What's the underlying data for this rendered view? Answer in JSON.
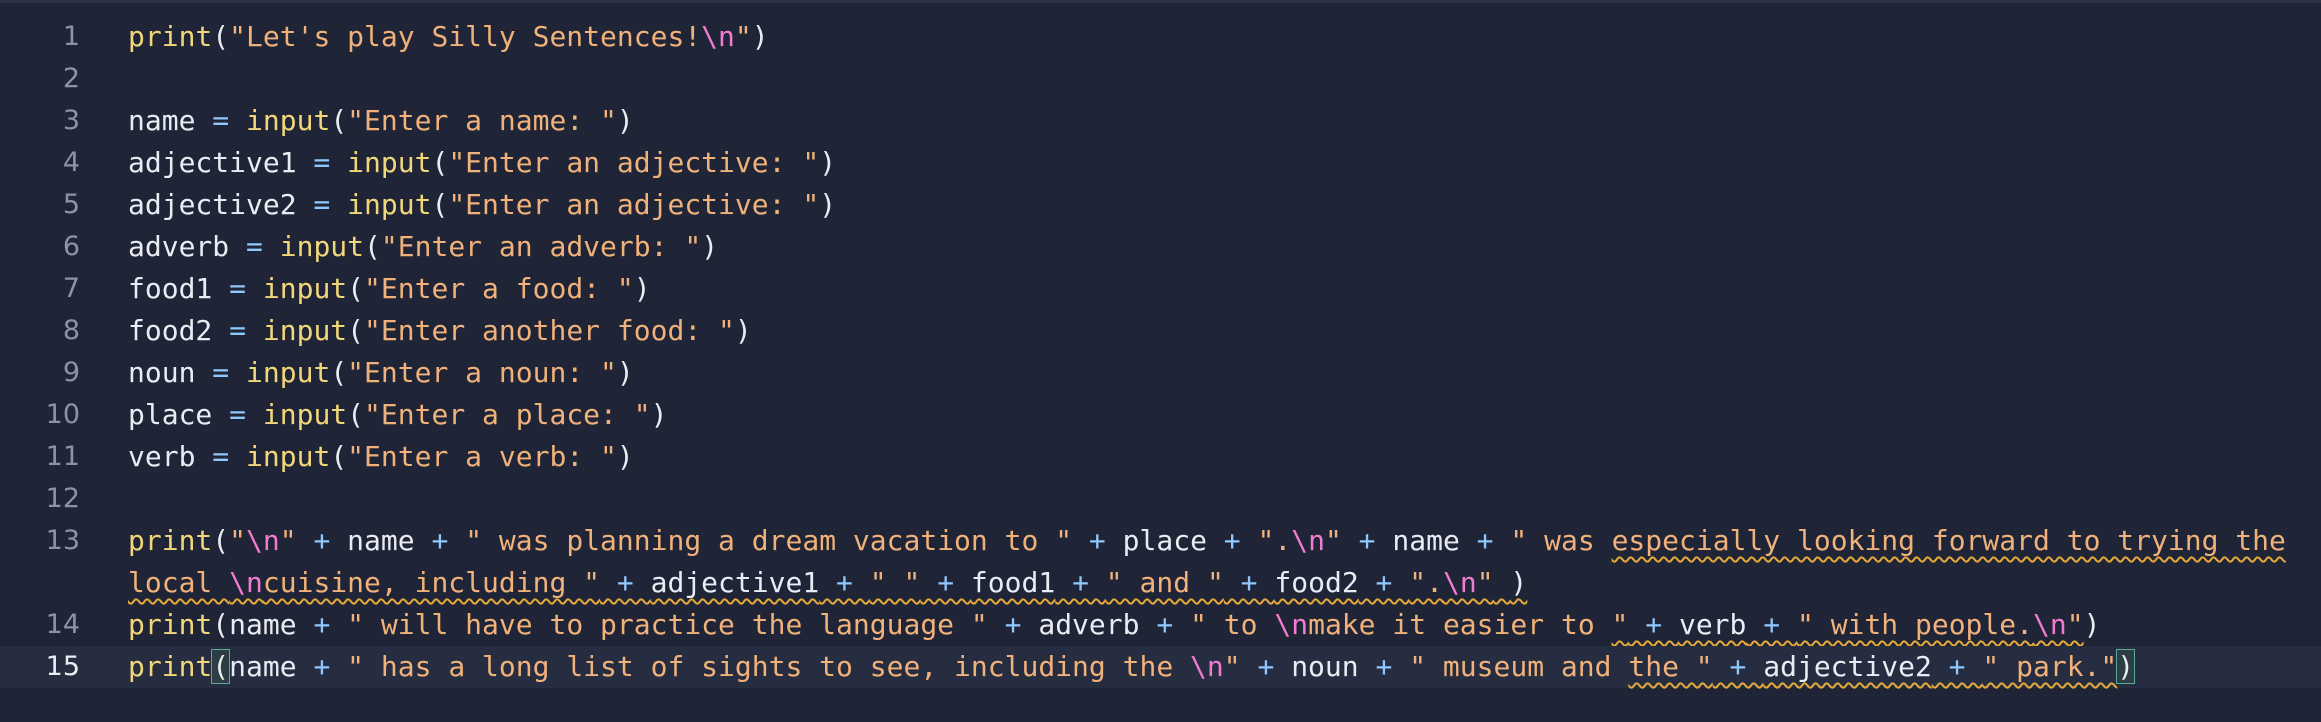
{
  "editor": {
    "active_line": "15",
    "lines": [
      {
        "number": "1",
        "t": {
          "a": "print",
          "b": "(",
          "c": "\"Let's play Silly Sentences!",
          "d": "\\n",
          "e": "\"",
          "f": ")"
        }
      },
      {
        "number": "2"
      },
      {
        "number": "3",
        "t": {
          "a": "name",
          "b": " = ",
          "c": "input",
          "d": "(",
          "e": "\"Enter a name: \"",
          "f": ")"
        }
      },
      {
        "number": "4",
        "t": {
          "a": "adjective1",
          "b": " = ",
          "c": "input",
          "d": "(",
          "e": "\"Enter an adjective: \"",
          "f": ")"
        }
      },
      {
        "number": "5",
        "t": {
          "a": "adjective2",
          "b": " = ",
          "c": "input",
          "d": "(",
          "e": "\"Enter an adjective: \"",
          "f": ")"
        }
      },
      {
        "number": "6",
        "t": {
          "a": "adverb",
          "b": " = ",
          "c": "input",
          "d": "(",
          "e": "\"Enter an adverb: \"",
          "f": ")"
        }
      },
      {
        "number": "7",
        "t": {
          "a": "food1",
          "b": " = ",
          "c": "input",
          "d": "(",
          "e": "\"Enter a food: \"",
          "f": ")"
        }
      },
      {
        "number": "8",
        "t": {
          "a": "food2",
          "b": " = ",
          "c": "input",
          "d": "(",
          "e": "\"Enter another food: \"",
          "f": ")"
        }
      },
      {
        "number": "9",
        "t": {
          "a": "noun",
          "b": " = ",
          "c": "input",
          "d": "(",
          "e": "\"Enter a noun: \"",
          "f": ")"
        }
      },
      {
        "number": "10",
        "t": {
          "a": "place",
          "b": " = ",
          "c": "input",
          "d": "(",
          "e": "\"Enter a place: \"",
          "f": ")"
        }
      },
      {
        "number": "11",
        "t": {
          "a": "verb",
          "b": " = ",
          "c": "input",
          "d": "(",
          "e": "\"Enter a verb: \"",
          "f": ")"
        }
      },
      {
        "number": "12"
      },
      {
        "number": "13",
        "t": {
          "a": "print",
          "b": "(",
          "c": "\"",
          "d": "\\n",
          "e": "\"",
          "f": " + ",
          "g": "name",
          "h": " + ",
          "i": "\" was planning a dream vacation to \"",
          "j": " + ",
          "k": "place",
          "l": " + ",
          "m": "\".",
          "n": "\\n",
          "o": "\"",
          "p": " + ",
          "q": "name",
          "r": " + ",
          "s": "\" was ",
          "u": "especially looking forward to trying the",
          "w1": "local ",
          "w2": "\\n",
          "w3": "cuisine, including \"",
          "w4": " + ",
          "w5": "adjective1",
          "w6": " + ",
          "w7": "\" \"",
          "w8": " + ",
          "w9": "food1",
          "w10": " + ",
          "w11": "\" and \"",
          "w12": " + ",
          "w13": "food2",
          "w14": " + ",
          "w15": "\".",
          "w16": "\\n",
          "w17": "\"",
          "w18": " ",
          "w19": ")"
        }
      },
      {
        "number": "14",
        "t": {
          "a": "print",
          "b": "(",
          "c": "name",
          "d": " + ",
          "e": "\" will have to practice the language \"",
          "f": " + ",
          "g": "adverb",
          "h": " + ",
          "i": "\" to ",
          "j": "\\n",
          "k": "make it easier to ",
          "l": "\"",
          "m": " + ",
          "n": "verb",
          "o": " + ",
          "p": "\" with people.",
          "q": "\\n",
          "r": "\"",
          "s": ")"
        }
      },
      {
        "number": "15",
        "t": {
          "a": "print",
          "b": "(",
          "c": "name",
          "d": " + ",
          "e": "\" has a long list of sights to see, including the ",
          "f": "\\n",
          "g": "\"",
          "h": " + ",
          "i": "noun",
          "j": " + ",
          "k": "\" museum and ",
          "l": "the \"",
          "m": " + ",
          "n": "adjective2",
          "o": " + ",
          "p": "\" park.\"",
          "q": ")"
        }
      }
    ]
  },
  "colors": {
    "background": "#1f2536",
    "active_line_bg": "#262d40",
    "function": "#f2d77a",
    "string": "#f0b17a",
    "escape": "#f07bd0",
    "operator": "#8fc7ff",
    "identifier": "#e9ecf2",
    "line_number": "#8b93a7",
    "warning_underline": "#e6a93a"
  }
}
